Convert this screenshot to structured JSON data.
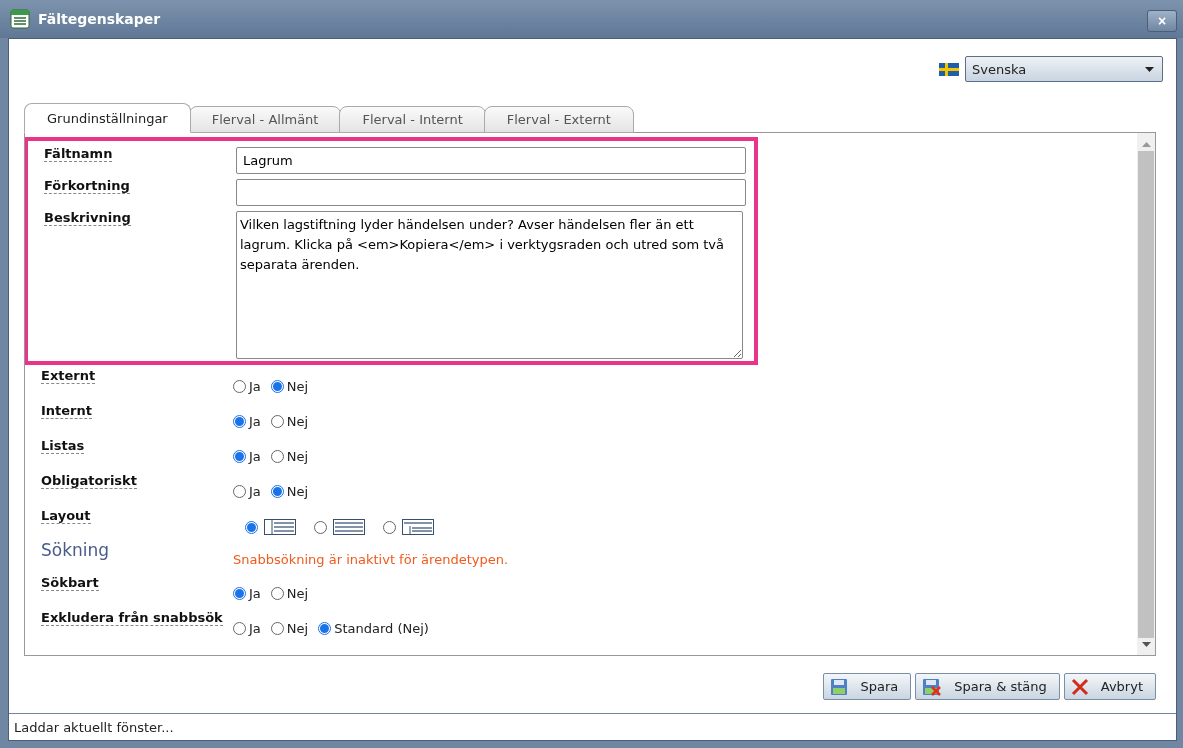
{
  "window": {
    "title": "Fältegenskaper",
    "close": "×"
  },
  "language": {
    "value": "Svenska"
  },
  "tabs": [
    {
      "label": "Grundinställningar",
      "selected": true
    },
    {
      "label": "Flerval - Allmänt",
      "selected": false
    },
    {
      "label": "Flerval - Internt",
      "selected": false
    },
    {
      "label": "Flerval - Externt",
      "selected": false
    }
  ],
  "highlighted_rows": [
    {
      "kind": "text",
      "label": "Fältnamn",
      "value": "Lagrum"
    },
    {
      "kind": "text",
      "label": "Förkortning"
    },
    {
      "kind": "textarea",
      "label": "Beskrivning",
      "value": "Vilken lagstiftning lyder händelsen under? Avser händelsen fler än ett lagrum. Klicka på <em>Kopiera</em> i verktygsraden och utred som två separata ärenden."
    }
  ],
  "rows": [
    {
      "kind": "radio",
      "label": "Externt",
      "options": [
        {
          "label": "Ja",
          "selected": false
        },
        {
          "label": "Nej",
          "selected": true
        }
      ]
    },
    {
      "kind": "radio",
      "label": "Internt",
      "options": [
        {
          "label": "Ja",
          "selected": true
        },
        {
          "label": "Nej",
          "selected": false
        }
      ]
    },
    {
      "kind": "radio",
      "label": "Listas",
      "options": [
        {
          "label": "Ja",
          "selected": true
        },
        {
          "label": "Nej",
          "selected": false
        }
      ]
    },
    {
      "kind": "radio",
      "label": "Obligatoriskt",
      "options": [
        {
          "label": "Ja",
          "selected": false
        },
        {
          "label": "Nej",
          "selected": true
        }
      ]
    },
    {
      "kind": "layout",
      "label": "Layout",
      "options": [
        {
          "selected": true
        },
        {
          "selected": false
        },
        {
          "selected": false
        }
      ]
    },
    {
      "kind": "section",
      "label": "Sökning",
      "note": "Snabbsökning är inaktivt för ärendetypen."
    },
    {
      "kind": "radio",
      "label": "Sökbart",
      "options": [
        {
          "label": "Ja",
          "selected": true
        },
        {
          "label": "Nej",
          "selected": false
        }
      ]
    },
    {
      "kind": "radio",
      "label": "Exkludera från snabbsök",
      "options": [
        {
          "label": "Ja",
          "selected": false
        },
        {
          "label": "Nej",
          "selected": false
        },
        {
          "label": "Standard (Nej)",
          "selected": true
        }
      ]
    }
  ],
  "buttons": [
    {
      "kind": "save",
      "label": "Spara"
    },
    {
      "kind": "save-close",
      "label": "Spara & stäng"
    },
    {
      "kind": "cancel",
      "label": "Avbryt"
    }
  ],
  "status_bar": {
    "text": "Laddar aktuellt fönster..."
  }
}
